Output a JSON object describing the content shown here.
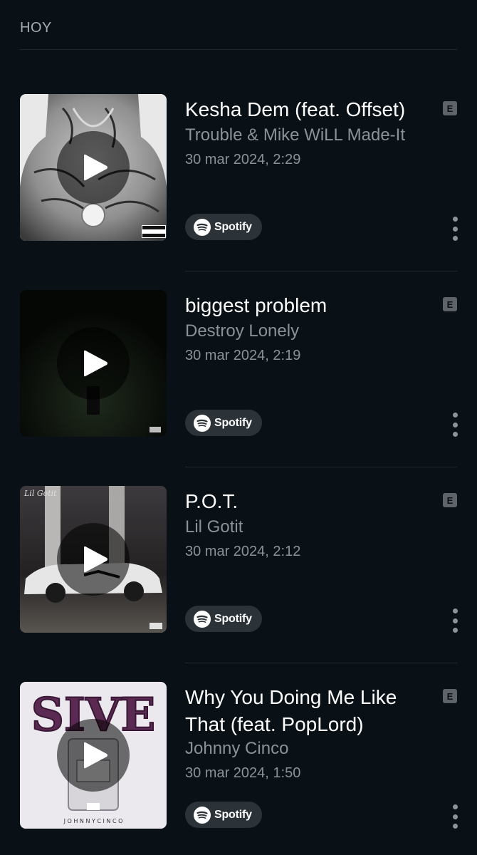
{
  "section": {
    "title": "HOY"
  },
  "tracks": [
    {
      "title": "Kesha Dem (feat. Offset)",
      "artist": "Trouble & Mike WiLL Made-It",
      "date": "30 mar 2024, 2:29",
      "explicit": "E",
      "service": "Spotify",
      "cover_theme": "grayscale-tattoo"
    },
    {
      "title": "biggest problem",
      "artist": "Destroy Lonely",
      "date": "30 mar 2024, 2:19",
      "explicit": "E",
      "service": "Spotify",
      "cover_theme": "dark-night"
    },
    {
      "title": "P.O.T.",
      "artist": "Lil Gotit",
      "date": "30 mar 2024, 2:12",
      "explicit": "E",
      "service": "Spotify",
      "cover_theme": "car-scene",
      "cover_text": "Lil Gotit"
    },
    {
      "title": "Why You Doing Me Like That (feat. PopLord)",
      "artist": "Johnny Cinco",
      "date": "30 mar 2024, 1:50",
      "explicit": "E",
      "service": "Spotify",
      "cover_theme": "sive-bottle",
      "cover_text": "SIVE",
      "cover_footer": "J O H N N Y   C I N C O"
    }
  ],
  "colors": {
    "background": "#0a1116",
    "secondary_text": "#8b9297",
    "pill": "#2c3338"
  },
  "icons": [
    "play-icon",
    "spotify-icon",
    "more-vertical-icon",
    "explicit-badge"
  ]
}
